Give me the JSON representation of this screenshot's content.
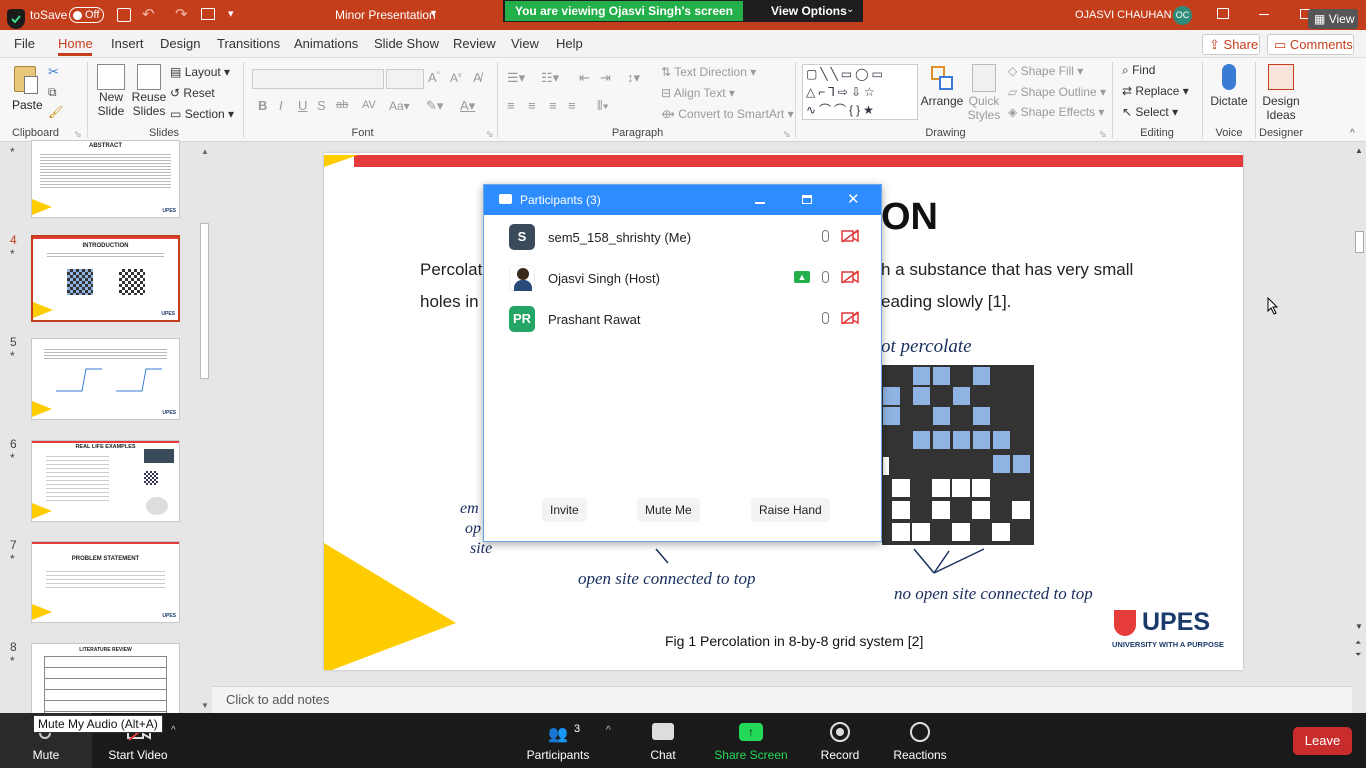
{
  "window": {
    "autosave_label": "toSave",
    "autosave_state": "Off",
    "doc_title": "Minor Presentation",
    "user_name": "OJASVI CHAUHAN",
    "user_initials": "OC",
    "view_button": "View"
  },
  "zoom_share_banner": {
    "text": "You are viewing Ojasvi Singh's screen",
    "view_options": "View Options"
  },
  "tabs": [
    "File",
    "Home",
    "Insert",
    "Design",
    "Transitions",
    "Animations",
    "Slide Show",
    "Review",
    "View",
    "Help"
  ],
  "active_tab": "Home",
  "share_label": "Share",
  "comments_label": "Comments",
  "ribbon": {
    "clipboard": {
      "paste": "Paste",
      "group": "Clipboard"
    },
    "slides": {
      "new_slide_1": "New",
      "new_slide_2": "Slide",
      "reuse_1": "Reuse",
      "reuse_2": "Slides",
      "layout": "Layout",
      "reset": "Reset",
      "section": "Section",
      "group": "Slides"
    },
    "font": {
      "group": "Font",
      "bold": "B",
      "italic": "I",
      "underline": "U",
      "shadow": "S",
      "strike": "ab"
    },
    "paragraph": {
      "text_direction": "Text Direction",
      "align_text": "Align Text",
      "convert_smartart": "Convert to SmartArt",
      "group": "Paragraph"
    },
    "drawing": {
      "arrange": "Arrange",
      "quick_styles_1": "Quick",
      "quick_styles_2": "Styles",
      "shape_fill": "Shape Fill",
      "shape_outline": "Shape Outline",
      "shape_effects": "Shape Effects",
      "group": "Drawing"
    },
    "editing": {
      "find": "Find",
      "replace": "Replace",
      "select": "Select",
      "group": "Editing"
    },
    "voice": {
      "dictate": "Dictate",
      "group": "Voice"
    },
    "designer": {
      "design_ideas_1": "Design",
      "design_ideas_2": "Ideas",
      "group": "Designer"
    }
  },
  "thumbnails": [
    {
      "num": "",
      "title": "ABSTRACT"
    },
    {
      "num": "4",
      "title": "INTRODUCTION"
    },
    {
      "num": "5",
      "title": ""
    },
    {
      "num": "6",
      "title": "REAL LIFE EXAMPLES"
    },
    {
      "num": "7",
      "title": "PROBLEM STATEMENT"
    },
    {
      "num": "8",
      "title": "LITERATURE REVIEW"
    }
  ],
  "thumb_logo": "UPES",
  "slide": {
    "title_fragment": "ON",
    "body_line1_left": "Percolat",
    "body_line1_right": "h a substance that has very small",
    "body_line2_left": "holes in",
    "body_line2_right": "eading slowly [1].",
    "fig_label_right": "ot percolate",
    "fig_label_left_1": "em",
    "fig_label_left_2": "op",
    "fig_label_left_3": "site",
    "open_site_caption": "open site connected to top",
    "no_open_site_caption": "no open site connected to top",
    "fig_caption": "Fig 1 Percolation in 8-by-8 grid system [2]",
    "logo_text": "UPES",
    "logo_tagline": "UNIVERSITY WITH A PURPOSE"
  },
  "notes_placeholder": "Click to add notes",
  "participants_dialog": {
    "title": "Participants (3)",
    "participants": [
      {
        "initials": "S",
        "name": "sem5_158_shrishty (Me)",
        "avatar_color": "#3a4a5a"
      },
      {
        "initials": "",
        "name": "Ojasvi Singh (Host)",
        "avatar_color": "#8b6a4a"
      },
      {
        "initials": "PR",
        "name": "Prashant Rawat",
        "avatar_color": "#23a566"
      }
    ],
    "invite": "Invite",
    "mute_me": "Mute Me",
    "raise_hand": "Raise Hand"
  },
  "zoom_toolbar": {
    "mute": "Mute",
    "start_video": "Start Video",
    "participants": "Participants",
    "participants_count": "3",
    "chat": "Chat",
    "share_screen": "Share Screen",
    "record": "Record",
    "reactions": "Reactions",
    "leave": "Leave",
    "tooltip": "Mute My Audio (Alt+A)"
  },
  "colors": {
    "ppt_accent": "#c43e1c",
    "zoom_blue": "#2d8cff",
    "zoom_green": "#23d959",
    "leave_red": "#c92c2c",
    "slide_yellow": "#ffcc00",
    "slide_red": "#e63b3b",
    "grid_blue": "#8fb3e3",
    "grid_dark": "#333333"
  }
}
